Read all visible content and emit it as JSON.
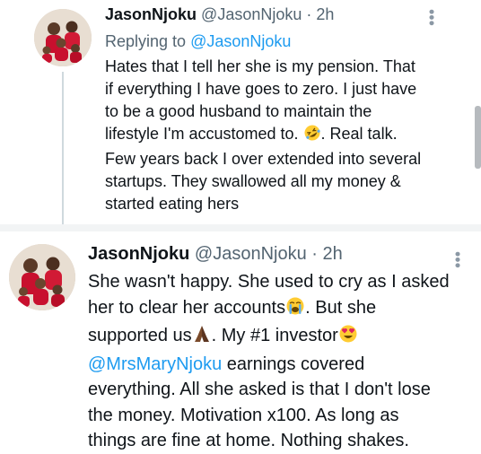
{
  "tweets": [
    {
      "author_name": "JasonNjoku",
      "author_handle": "@JasonNjoku",
      "separator": "·",
      "time": "2h",
      "replying_prefix": "Replying to ",
      "replying_to": "@JasonNjoku",
      "lines": [
        "Hates that I tell her she is my pension. That",
        "if everything I have goes to zero. I just have",
        "to be a good husband to maintain the",
        "lifestyle I'm accustomed to. ",
        ". Real talk.",
        "Few years back I over extended into several",
        "startups. They swallowed all my money &",
        "started eating hers"
      ],
      "emoji": [
        "rolling-on-floor-laughing-emoji"
      ]
    },
    {
      "author_name": "JasonNjoku",
      "author_handle": "@JasonNjoku",
      "separator": "·",
      "time": "2h",
      "lines": [
        "She wasn't happy. She used to cry as I asked",
        "her to clear her accounts",
        ". But she",
        "supported us",
        ". My #1 investor",
        "@MrsMaryNjoku",
        " earnings covered",
        "everything. All she asked is that I don't lose",
        "the money. Motivation x100. As long as",
        "things are fine at home. Nothing shakes."
      ],
      "emoji": [
        "loudly-crying-face-emoji",
        "folded-hands-emoji",
        "heart-eyes-emoji"
      ]
    }
  ],
  "colors": {
    "text": "#0f1419",
    "secondary": "#536471",
    "link": "#1d9bf0",
    "separator_band": "#f2f4f5"
  }
}
